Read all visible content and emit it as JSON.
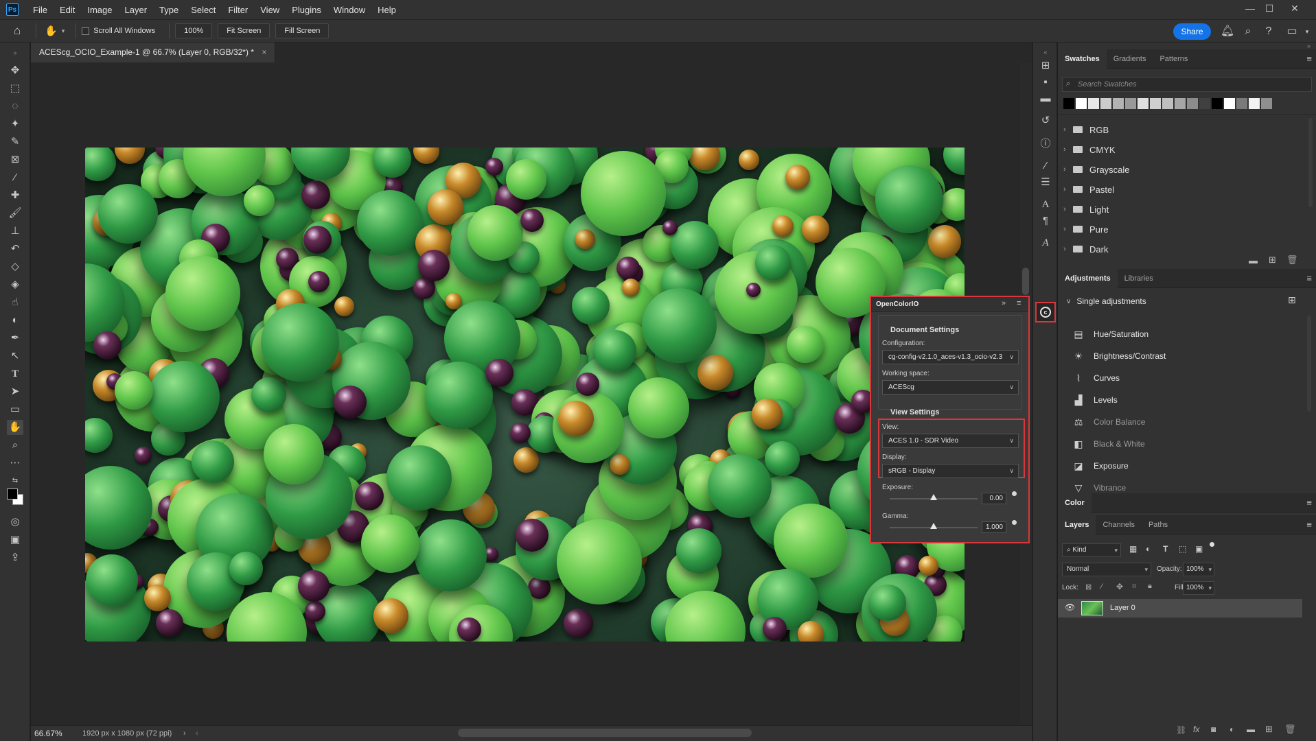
{
  "app": {
    "logo": "Ps"
  },
  "menu": [
    "File",
    "Edit",
    "Image",
    "Layer",
    "Type",
    "Select",
    "Filter",
    "View",
    "Plugins",
    "Window",
    "Help"
  ],
  "window_controls": {
    "minimize": "—",
    "maximize": "☐",
    "close": "✕"
  },
  "options_bar": {
    "scroll_all_windows": "Scroll All Windows",
    "zoom": "100%",
    "fit_screen": "Fit Screen",
    "fill_screen": "Fill Screen",
    "share": "Share"
  },
  "document": {
    "tab_title": "ACEScg_OCIO_Example-1 @ 66.7% (Layer 0, RGB/32*) *",
    "close": "×"
  },
  "status": {
    "zoom": "66.67%",
    "info": "1920 px x 1080 px (72 ppi)"
  },
  "swatches_panel": {
    "tabs": [
      "Swatches",
      "Gradients",
      "Patterns"
    ],
    "search_placeholder": "Search Swatches",
    "swatch_colors": [
      "#000000",
      "#ffffff",
      "#e8e8e8",
      "#cccccc",
      "#b3b3b3",
      "#999999",
      "#e0e0e0",
      "#d0d0d0",
      "#bfbfbf",
      "#a6a6a6",
      "#8c8c8c",
      "#404040",
      "#000000",
      "#ffffff",
      "#7a7a7a",
      "#f2f2f2",
      "#8f8f8f"
    ],
    "folders": [
      "RGB",
      "CMYK",
      "Grayscale",
      "Pastel",
      "Light",
      "Pure",
      "Dark"
    ]
  },
  "adjustments_panel": {
    "tabs": [
      "Adjustments",
      "Libraries"
    ],
    "group": "Single adjustments",
    "items": [
      {
        "label": "Hue/Saturation",
        "icon": "hue-saturation-icon"
      },
      {
        "label": "Brightness/Contrast",
        "icon": "brightness-contrast-icon"
      },
      {
        "label": "Curves",
        "icon": "curves-icon"
      },
      {
        "label": "Levels",
        "icon": "levels-icon"
      },
      {
        "label": "Color Balance",
        "icon": "color-balance-icon"
      },
      {
        "label": "Black & White",
        "icon": "black-white-icon"
      },
      {
        "label": "Exposure",
        "icon": "exposure-icon"
      },
      {
        "label": "Vibrance",
        "icon": "vibrance-icon"
      }
    ]
  },
  "color_panel": {
    "title": "Color"
  },
  "layers_panel": {
    "tabs": [
      "Layers",
      "Channels",
      "Paths"
    ],
    "filter": "Kind",
    "blend_mode": "Normal",
    "opacity_label": "Opacity:",
    "opacity": "100%",
    "lock_label": "Lock:",
    "fill_label": "Fill:",
    "fill": "100%",
    "layer_name": "Layer 0"
  },
  "ocio_panel": {
    "title": "OpenColorIO",
    "document_settings": "Document Settings",
    "configuration_label": "Configuration:",
    "configuration": "cg-config-v2.1.0_aces-v1.3_ocio-v2.3",
    "working_space_label": "Working space:",
    "working_space": "ACEScg",
    "view_settings": "View Settings",
    "view_label": "View:",
    "view": "ACES 1.0 - SDR Video",
    "display_label": "Display:",
    "display": "sRGB - Display",
    "exposure_label": "Exposure:",
    "exposure": "0.00",
    "gamma_label": "Gamma:",
    "gamma": "1.000",
    "exposure_fraction": 0.5,
    "gamma_fraction": 0.5
  },
  "colors": {
    "accent_red": "#d9373c",
    "share_blue": "#1473e6"
  }
}
